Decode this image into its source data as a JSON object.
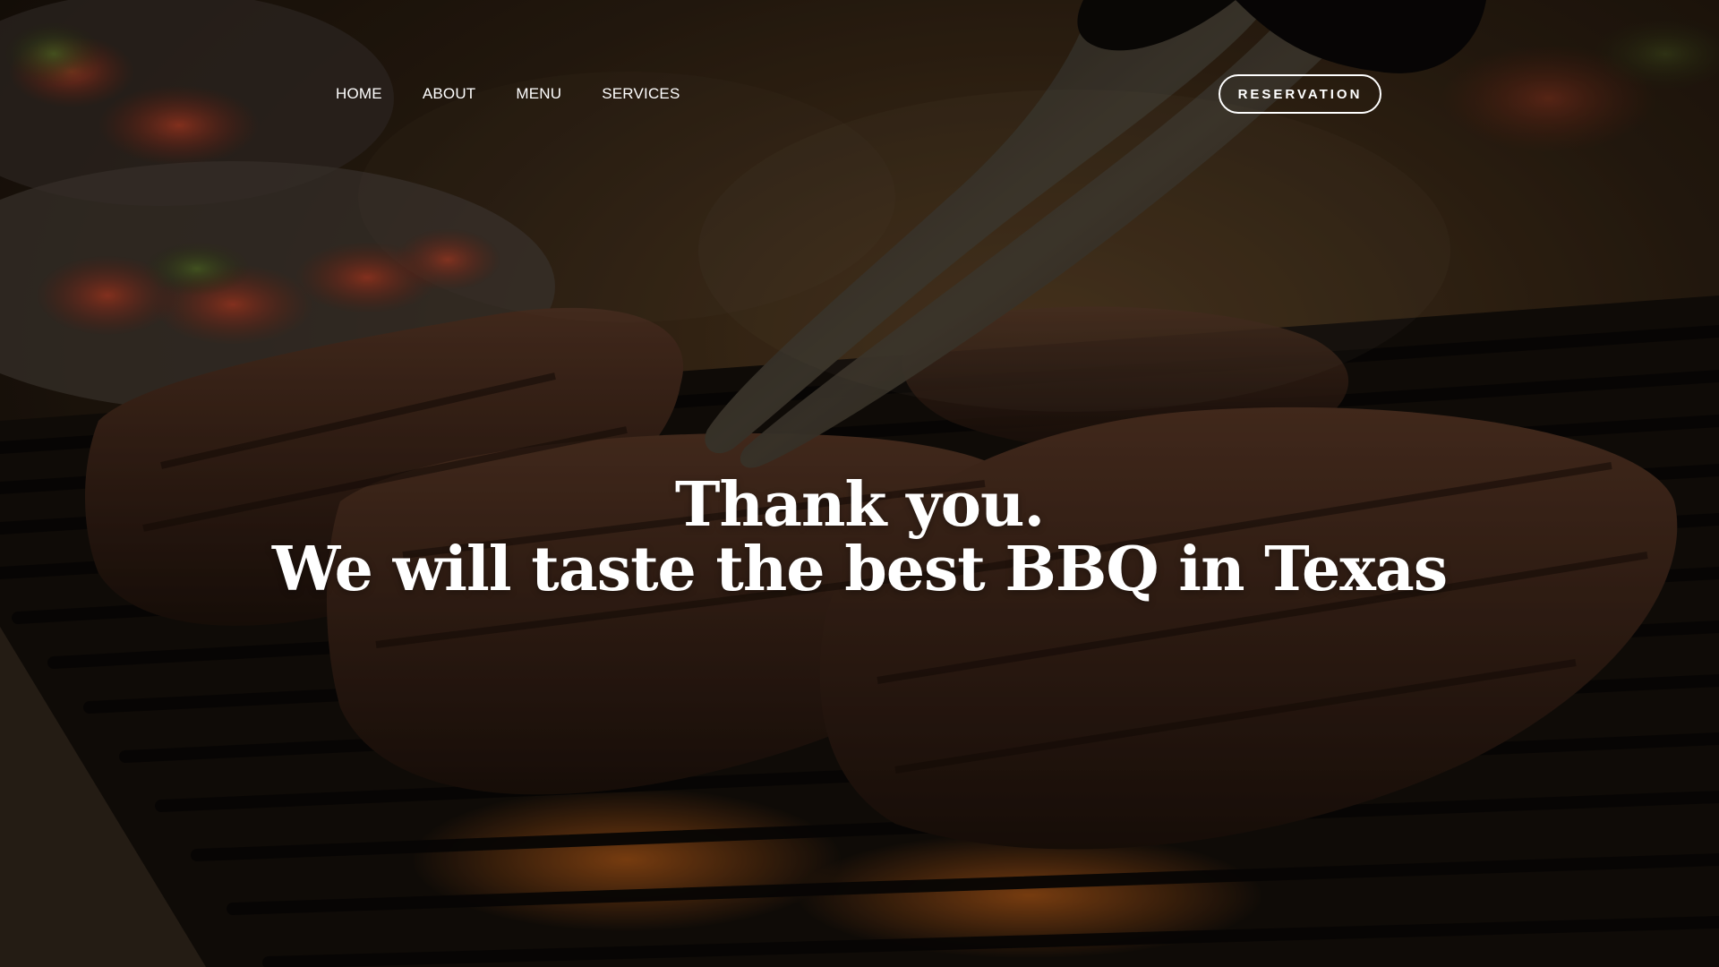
{
  "nav": {
    "items": [
      {
        "label": "HOME"
      },
      {
        "label": "ABOUT"
      },
      {
        "label": "MENU"
      },
      {
        "label": "SERVICES"
      }
    ]
  },
  "cta": {
    "reservation_label": "RESERVATION"
  },
  "hero": {
    "line1": "Thank you.",
    "line2": "We will taste the best BBQ in Texas"
  },
  "colors": {
    "text": "#ffffff",
    "overlay_dark": "#120c07",
    "meat": "#4a2c1d",
    "ember": "#d46a1a"
  },
  "icons": {
    "background": "grilled-steak-photo"
  }
}
